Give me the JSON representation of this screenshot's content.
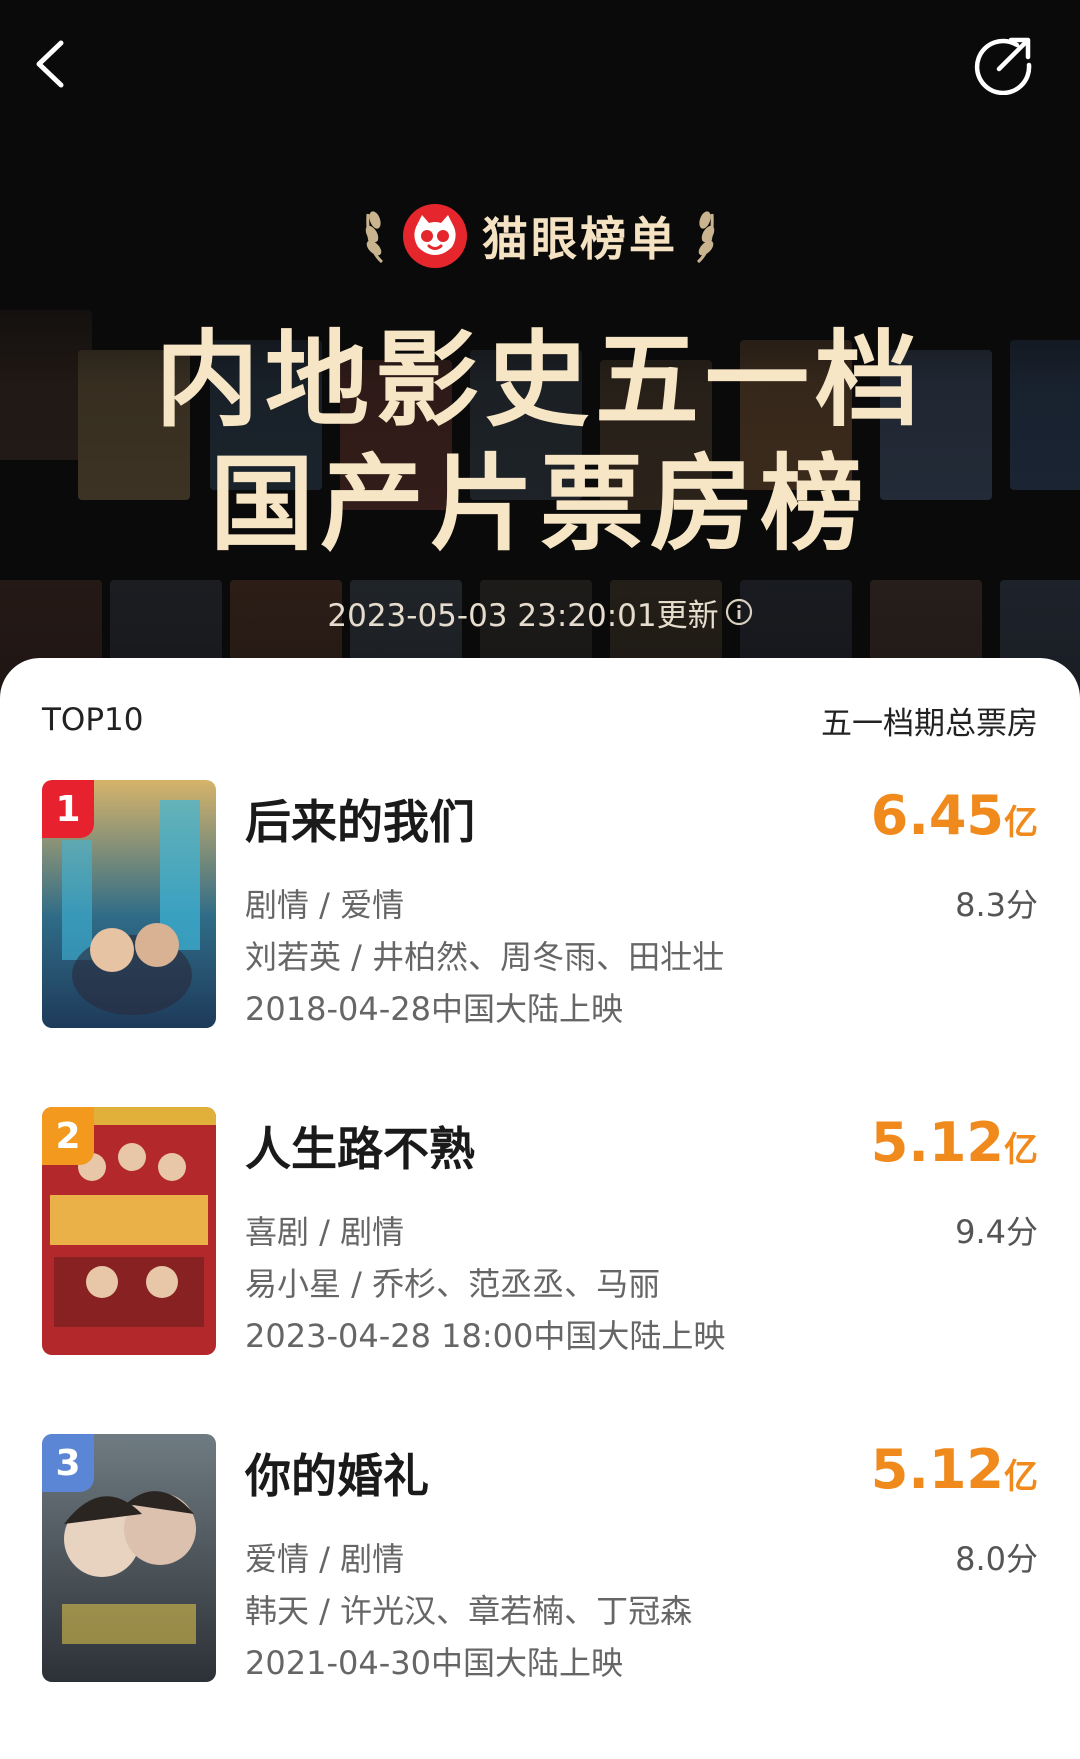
{
  "header": {
    "brand": "猫眼榜单",
    "title_line1": "内地影史五一档",
    "title_line2": "国产片票房榜",
    "updated": "2023-05-03 23:20:01更新"
  },
  "list": {
    "left_label": "TOP10",
    "right_label": "五一档期总票房",
    "items": [
      {
        "rank": "1",
        "title": "后来的我们",
        "box_office": "6.45",
        "unit": "亿",
        "score": "8.3分",
        "genre": "剧情 / 爱情",
        "cast": "刘若英 / 井柏然、周冬雨、田壮壮",
        "release": "2018-04-28中国大陆上映"
      },
      {
        "rank": "2",
        "title": "人生路不熟",
        "box_office": "5.12",
        "unit": "亿",
        "score": "9.4分",
        "genre": "喜剧 / 剧情",
        "cast": "易小星 / 乔杉、范丞丞、马丽",
        "release": "2023-04-28 18:00中国大陆上映"
      },
      {
        "rank": "3",
        "title": "你的婚礼",
        "box_office": "5.12",
        "unit": "亿",
        "score": "8.0分",
        "genre": "爱情 / 剧情",
        "cast": "韩天 / 许光汉、章若楠、丁冠森",
        "release": "2021-04-30中国大陆上映"
      }
    ]
  },
  "colors": {
    "accent_orange": "#f08a1d",
    "rank1": "#e8212e",
    "rank2": "#f39a1e",
    "rank3": "#5b86d6",
    "headline_cream": "#f7e6c6",
    "logo_red": "#e5262c"
  },
  "icons": {
    "back": "chevron-left-icon",
    "share": "share-icon",
    "logo": "cat-logo-icon",
    "laurel": "laurel-icon",
    "info": "info-icon"
  }
}
